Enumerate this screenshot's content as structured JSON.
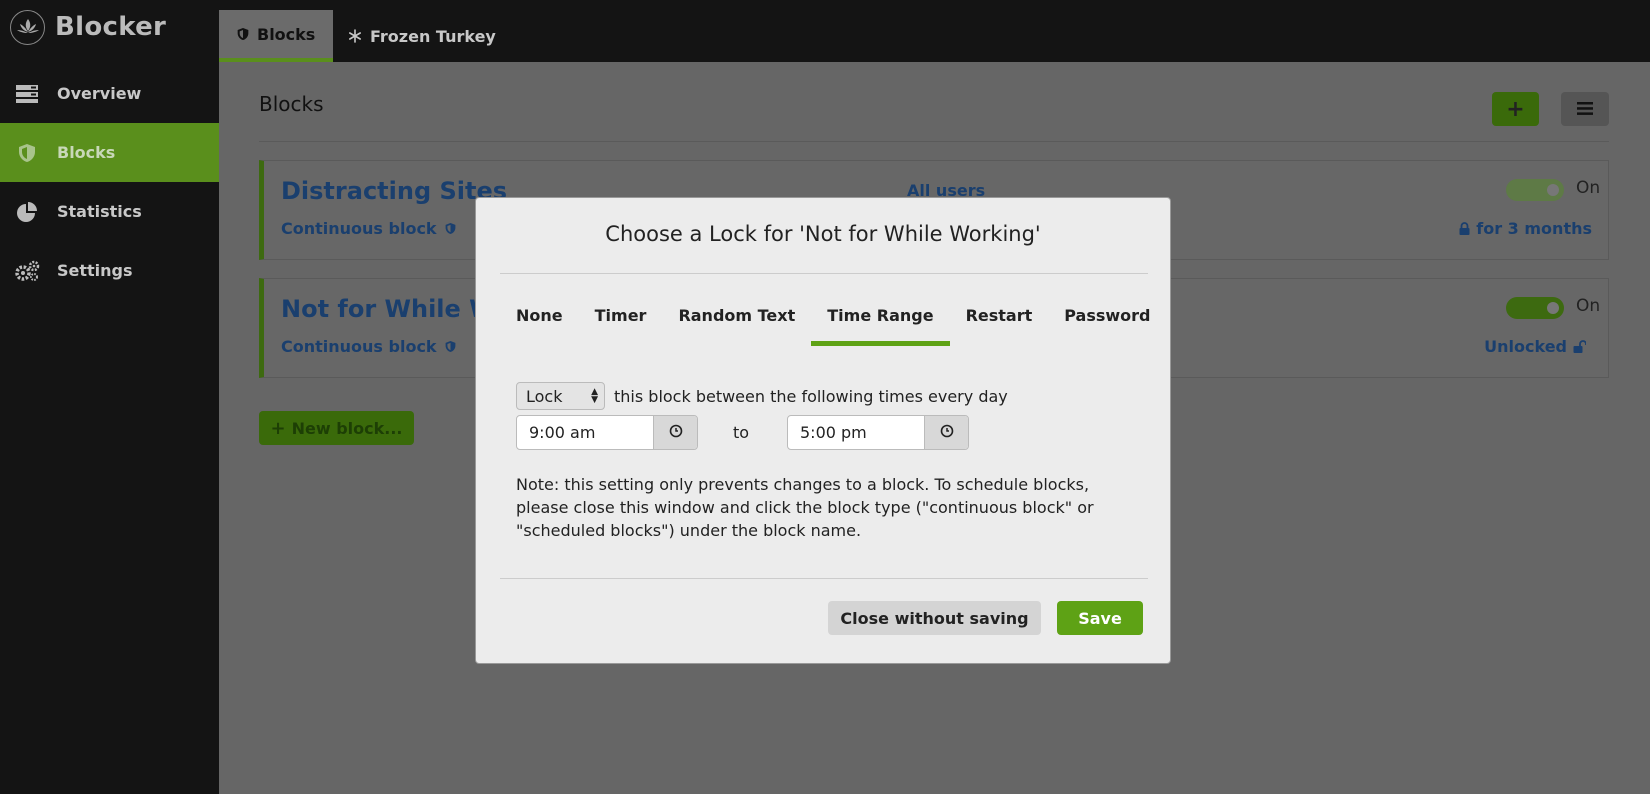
{
  "app": {
    "name": "Blocker",
    "logo_icon": "lotus-icon"
  },
  "sidebar": {
    "items": [
      {
        "label": "Overview",
        "icon": "server-icon"
      },
      {
        "label": "Blocks",
        "icon": "shield-icon",
        "active": true
      },
      {
        "label": "Statistics",
        "icon": "pie-chart-icon"
      },
      {
        "label": "Settings",
        "icon": "gears-icon"
      }
    ]
  },
  "topbar": {
    "tabs": [
      {
        "label": "Blocks",
        "icon": "shield-icon",
        "active": true
      },
      {
        "label": "Frozen Turkey",
        "icon": "snowflake-icon"
      }
    ]
  },
  "main": {
    "title": "Blocks",
    "add_button": "+",
    "new_block_button": "New block...",
    "blocks": [
      {
        "name": "Distracting Sites",
        "type": "Continuous block",
        "users": "All users",
        "toggle": "On",
        "lock_status": "for 3 months"
      },
      {
        "name": "Not for While Wo",
        "type": "Continuous block",
        "users": "",
        "toggle": "On",
        "lock_status": "Unlocked"
      }
    ]
  },
  "modal": {
    "title": "Choose a Lock for 'Not for While Working'",
    "tabs": [
      "None",
      "Timer",
      "Random Text",
      "Time Range",
      "Restart",
      "Password"
    ],
    "active_tab": "Time Range",
    "lock_select": "Lock",
    "lock_text": "this block between the following times every day",
    "start_time": "9:00 am",
    "to_label": "to",
    "end_time": "5:00 pm",
    "note": "Note: this setting only prevents changes to a block. To schedule blocks, please close this window and click the block type (\"continuous block\" or \"scheduled blocks\") under the block name.",
    "close_button": "Close without saving",
    "save_button": "Save"
  },
  "colors": {
    "accent_green": "#5ea215",
    "link_blue": "#1a3f6e",
    "sidebar_bg": "#141414"
  }
}
